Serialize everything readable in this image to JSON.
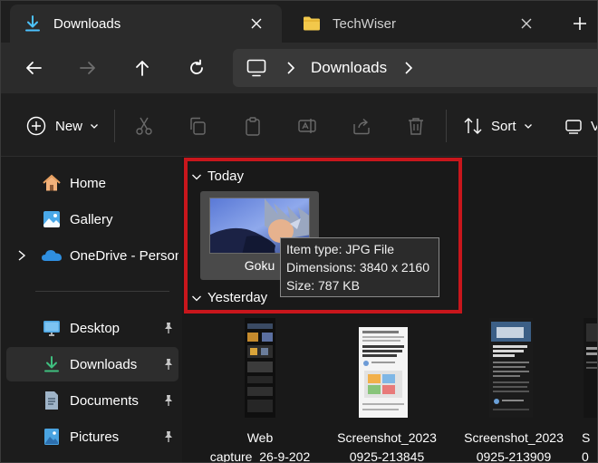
{
  "tabs": [
    {
      "label": "Downloads",
      "icon": "download-icon",
      "active": true
    },
    {
      "label": "TechWiser",
      "icon": "folder-icon",
      "active": false
    }
  ],
  "address": {
    "crumb": "Downloads"
  },
  "toolbar": {
    "new_label": "New",
    "sort_label": "Sort",
    "view_label": "V"
  },
  "sidebar": {
    "items": [
      {
        "label": "Home",
        "icon": "home-icon"
      },
      {
        "label": "Gallery",
        "icon": "gallery-icon"
      },
      {
        "label": "OneDrive - Persona",
        "icon": "onedrive-icon"
      },
      {
        "label": "Desktop",
        "icon": "desktop-icon"
      },
      {
        "label": "Downloads",
        "icon": "download-icon"
      },
      {
        "label": "Documents",
        "icon": "documents-icon"
      },
      {
        "label": "Pictures",
        "icon": "pictures-icon"
      }
    ]
  },
  "groups": {
    "today": "Today",
    "yesterday": "Yesterday"
  },
  "selected_file": {
    "name": "Goku"
  },
  "tooltip": {
    "type_line": "Item type: JPG File",
    "dims_line": "Dimensions: 3840 x 2160",
    "size_line": "Size: 787 KB"
  },
  "files": [
    {
      "line1": "Web",
      "line2": "capture_26-9-202"
    },
    {
      "line1": "Screenshot_2023",
      "line2": "0925-213845"
    },
    {
      "line1": "Screenshot_2023",
      "line2": "0925-213909"
    },
    {
      "line1": "S",
      "line2": "0"
    }
  ],
  "colors": {
    "accent": "#4cc2ff",
    "folder": "#f2c84b",
    "highlight": "#c8161c"
  }
}
